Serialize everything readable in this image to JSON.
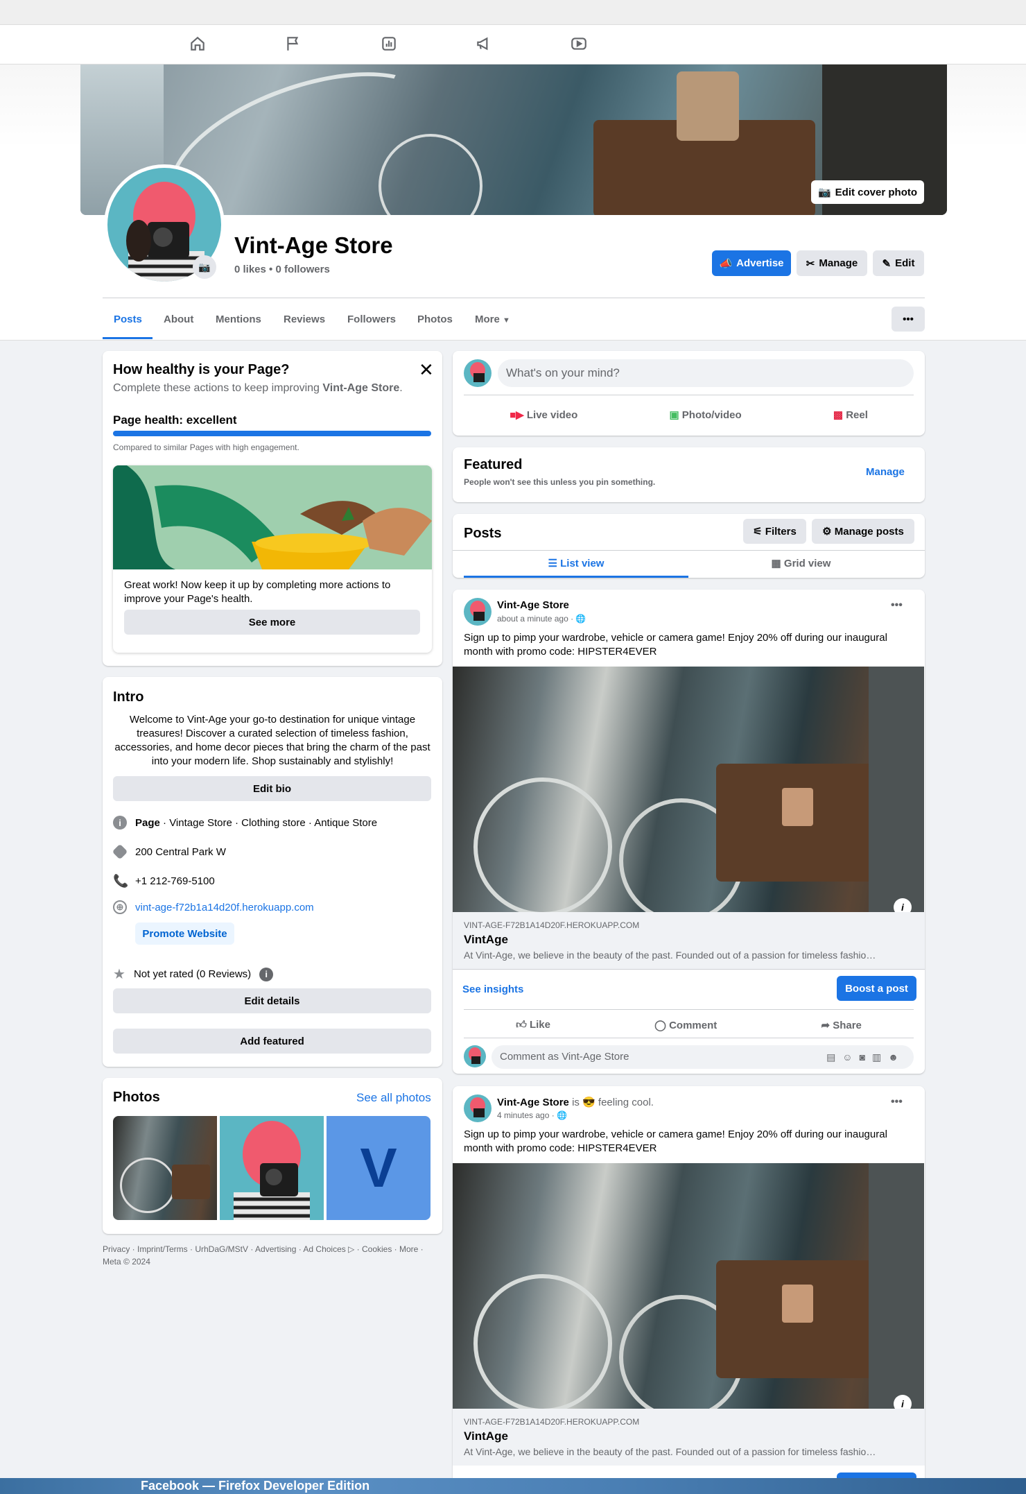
{
  "window": {
    "title": "Facebook — Firefox Developer Edition"
  },
  "topnav": {
    "icons": [
      "home-icon",
      "flag-icon",
      "insights-icon",
      "megaphone-icon",
      "video-icon"
    ]
  },
  "cover": {
    "edit_label": "Edit cover photo"
  },
  "page": {
    "name": "Vint-Age Store",
    "stats": "0 likes • 0 followers"
  },
  "actions": {
    "advertise": "Advertise",
    "manage": "Manage",
    "edit": "Edit"
  },
  "tabs": [
    "Posts",
    "About",
    "Mentions",
    "Reviews",
    "Followers",
    "Photos",
    "More"
  ],
  "health": {
    "title": "How healthy is your Page?",
    "subtitle_prefix": "Complete these actions to keep improving ",
    "subtitle_name": "Vint-Age Store",
    "subtitle_suffix": ".",
    "status": "Page health: excellent",
    "progress": 1.0,
    "compare": "Compared to similar Pages with high engagement.",
    "message": "Great work! Now keep it up by completing more actions to improve your Page's health.",
    "see_more": "See more"
  },
  "intro": {
    "title": "Intro",
    "bio": "Welcome to Vint-Age your go-to destination for unique vintage treasures! Discover a curated selection of timeless fashion, accessories, and home decor pieces that bring the charm of the past into your modern life. Shop sustainably and stylishly!",
    "edit_bio": "Edit bio",
    "category_label": "Page",
    "categories": " · Vintage Store · Clothing store · Antique Store",
    "address": "200 Central Park W",
    "phone": "+1 212-769-5100",
    "website": "vint-age-f72b1a14d20f.herokuapp.com",
    "promote": "Promote Website",
    "rating": "Not yet rated (0 Reviews)",
    "edit_details": "Edit details",
    "add_featured": "Add featured"
  },
  "photos": {
    "title": "Photos",
    "see_all": "See all photos",
    "v_letter": "V"
  },
  "footer": {
    "text": "Privacy · Imprint/Terms · UrhDaG/MStV · Advertising · Ad Choices ▷ · Cookies · More · Meta © 2024"
  },
  "composer": {
    "placeholder": "What's on your mind?",
    "live": "Live video",
    "photo": "Photo/video",
    "reel": "Reel"
  },
  "featured": {
    "title": "Featured",
    "subtitle": "People won't see this unless you pin something.",
    "manage": "Manage"
  },
  "posts_header": {
    "title": "Posts",
    "filters": "Filters",
    "manage_posts": "Manage posts",
    "list_view": "List view",
    "grid_view": "Grid view"
  },
  "posts": [
    {
      "author": "Vint-Age Store",
      "feeling": "",
      "time": "about a minute ago ·",
      "text": "Sign up to pimp your wardrobe, vehicle or camera game! Enjoy 20% off during our inaugural month with promo code: HIPSTER4EVER",
      "link_domain": "VINT-AGE-F72B1A14D20F.HEROKUAPP.COM",
      "link_title": "VintAge",
      "link_desc": "At Vint-Age, we believe in the beauty of the past. Founded out of a passion for timeless fashio…",
      "see_insights": "See insights",
      "boost": "Boost a post",
      "like": "Like",
      "comment": "Comment",
      "share": "Share",
      "comment_placeholder": "Comment as Vint-Age Store"
    },
    {
      "author": "Vint-Age Store",
      "feeling": " is 😎 feeling cool.",
      "time": "4 minutes ago ·",
      "text": "Sign up to pimp your wardrobe, vehicle or camera game! Enjoy 20% off during our inaugural month with promo code: HIPSTER4EVER",
      "link_domain": "VINT-AGE-F72B1A14D20F.HEROKUAPP.COM",
      "link_title": "VintAge",
      "link_desc": "At Vint-Age, we believe in the beauty of the past. Founded out of a passion for timeless fashio…"
    }
  ],
  "colors": {
    "accent": "#1b74e4",
    "background": "#f0f2f5"
  }
}
